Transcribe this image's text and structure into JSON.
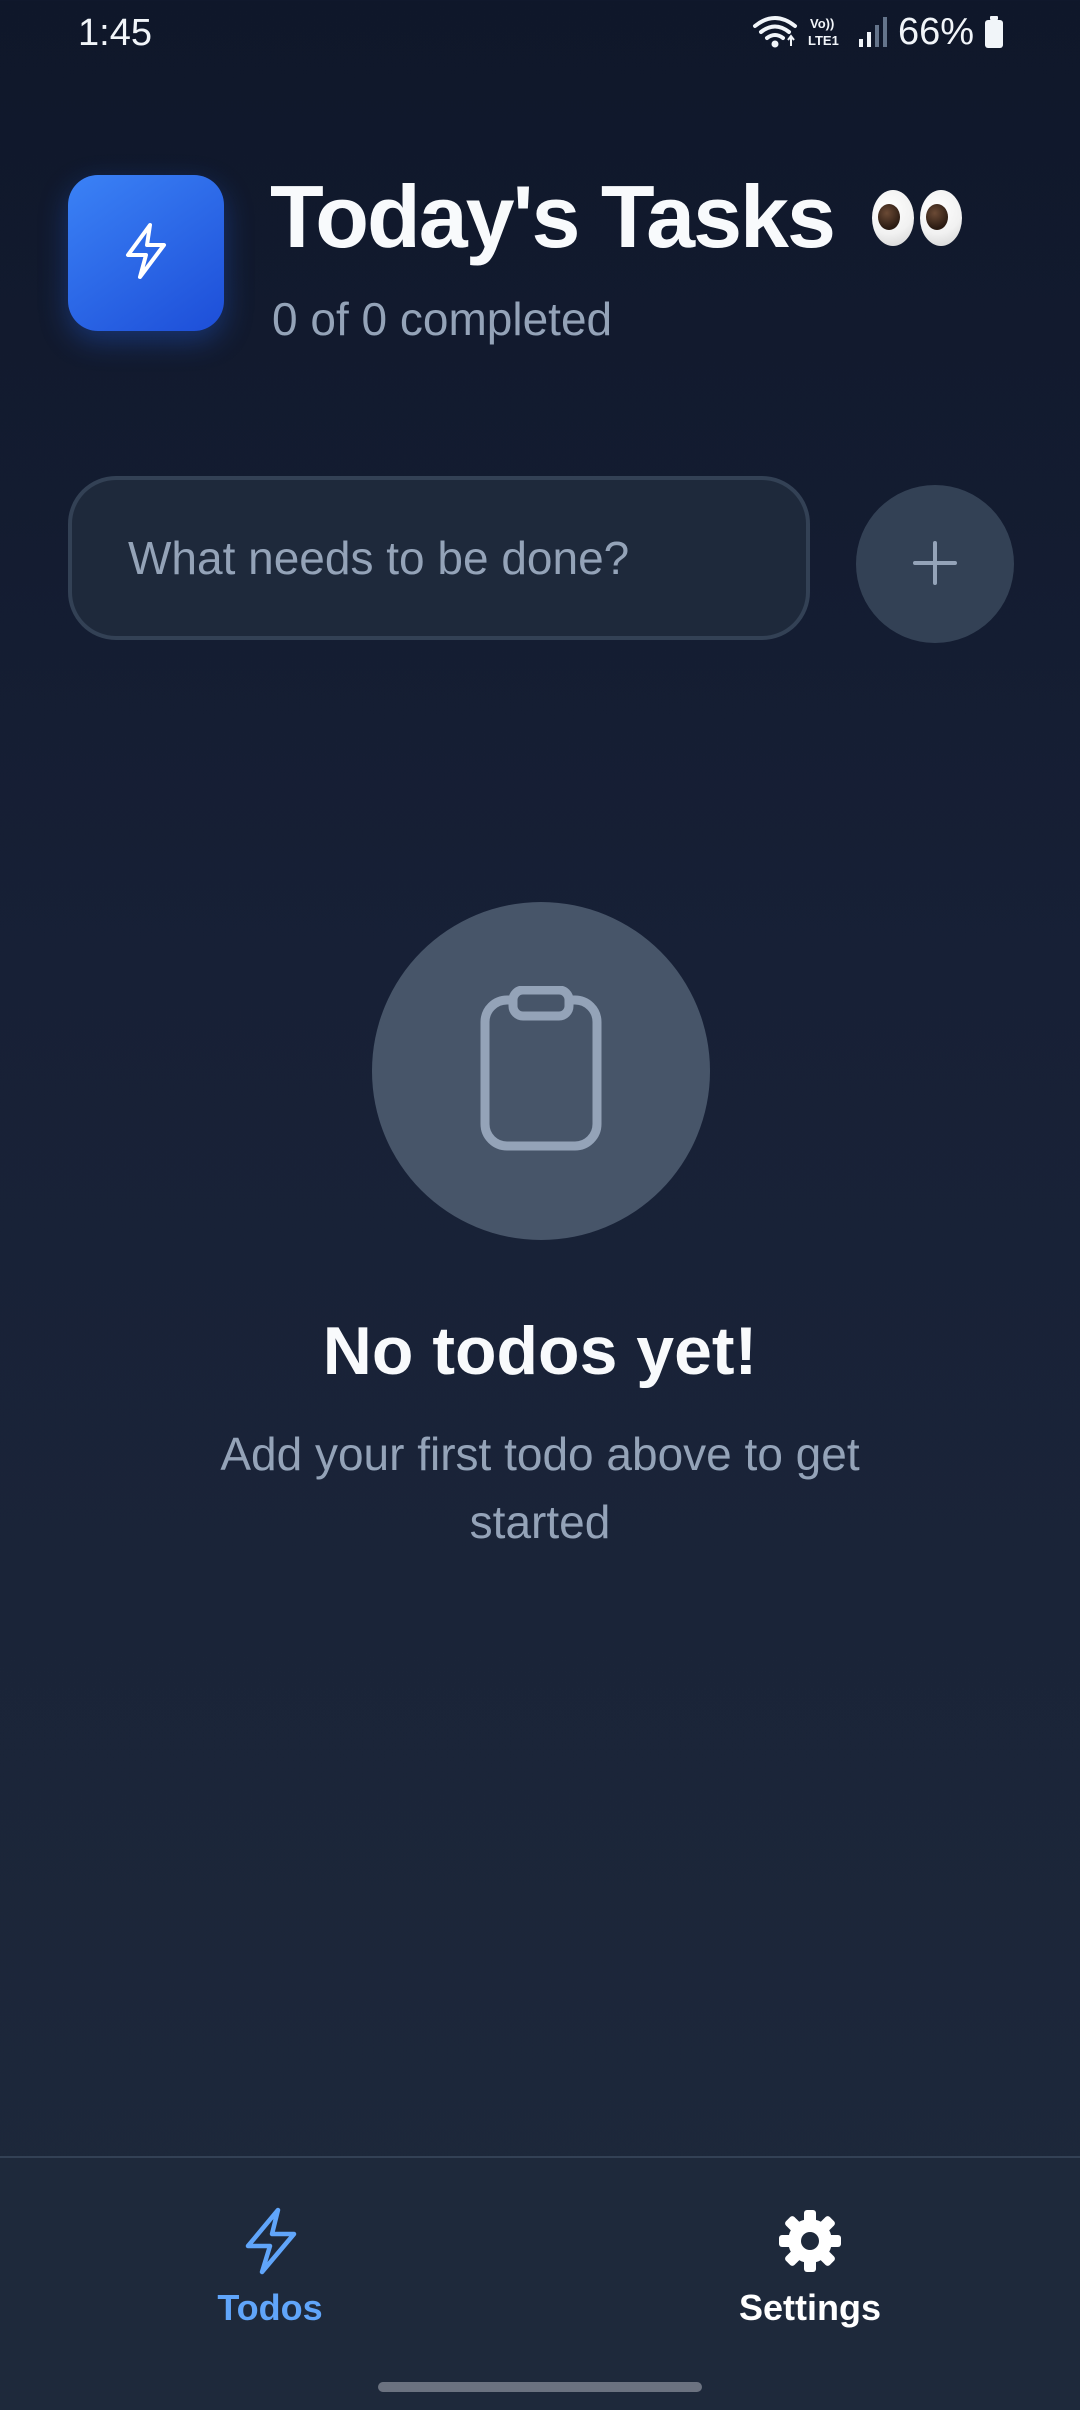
{
  "status_bar": {
    "time": "1:45",
    "battery_percent": "66%",
    "network": "VoLTE1",
    "icons": [
      "wifi-icon",
      "volte-icon",
      "signal-icon",
      "battery-icon"
    ]
  },
  "header": {
    "logo_icon": "lightning-bolt-icon",
    "title": "Today's Tasks",
    "title_emoji": "eyes-emoji",
    "progress_text": "0 of 0 completed"
  },
  "add_todo": {
    "placeholder": "What needs to be done?",
    "value": "",
    "button_icon": "plus-icon"
  },
  "empty_state": {
    "icon": "clipboard-icon",
    "title": "No todos yet!",
    "subtitle": "Add your first todo above to get started"
  },
  "bottom_nav": {
    "items": [
      {
        "label": "Todos",
        "icon": "lightning-bolt-icon",
        "active": true
      },
      {
        "label": "Settings",
        "icon": "gear-icon",
        "active": false
      }
    ]
  },
  "colors": {
    "background_top": "#0f172a",
    "background_bottom": "#1e293b",
    "accent": "#3b82f6",
    "active_nav": "#60a5fa",
    "muted_text": "#94a3b8"
  }
}
